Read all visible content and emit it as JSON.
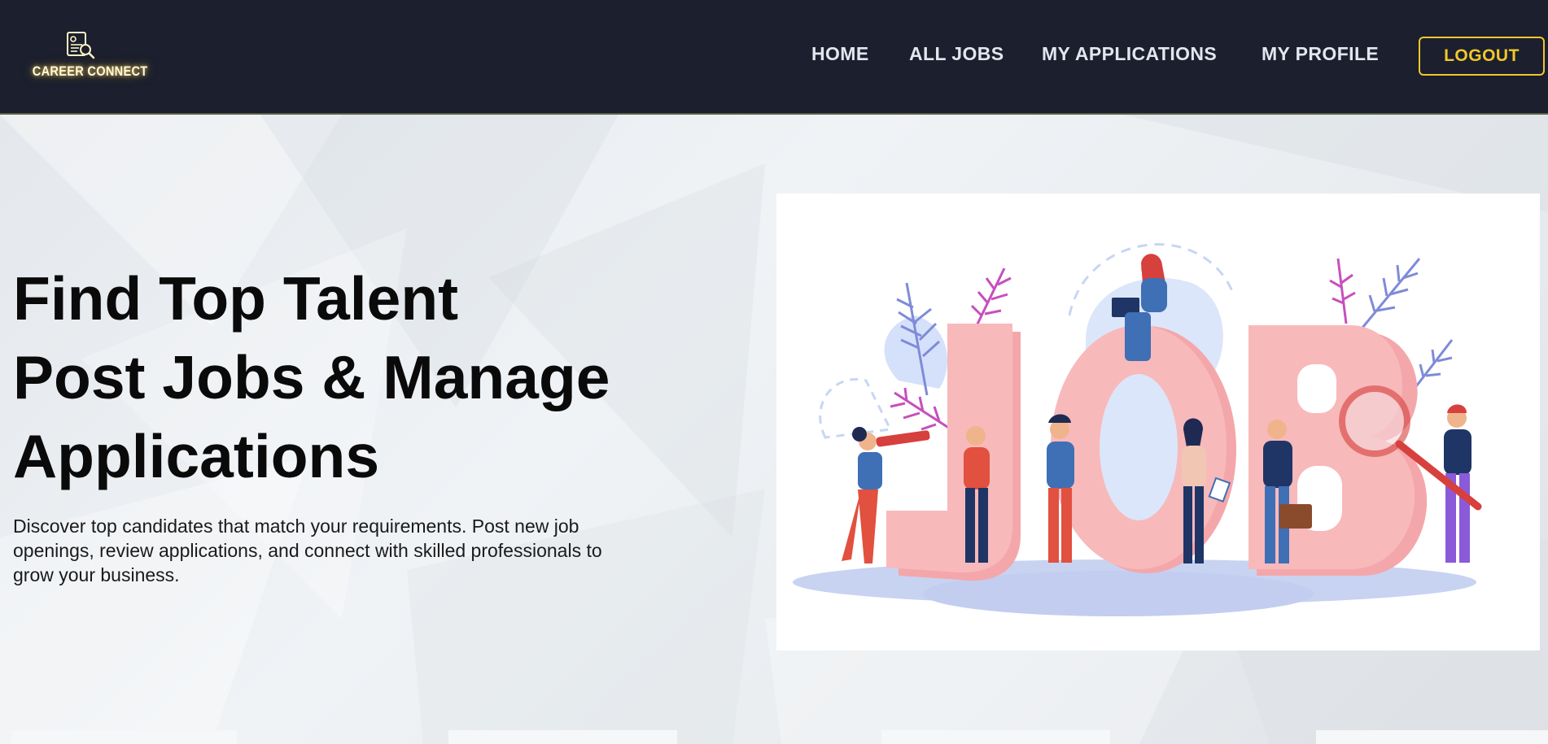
{
  "brand": {
    "name": "CAREER CONNECT",
    "icon": "resume-search-icon"
  },
  "nav": {
    "items": [
      {
        "label": "HOME"
      },
      {
        "label": "ALL JOBS"
      },
      {
        "label": "MY APPLICATIONS"
      },
      {
        "label": "MY PROFILE"
      }
    ],
    "logout_label": "LOGOUT"
  },
  "hero": {
    "title_lines": [
      "Find Top Talent",
      "Post Jobs & Manage",
      "Applications"
    ],
    "description": "Discover top candidates that match your requirements. Post new job openings, review applications, and connect with skilled professionals to grow your business.",
    "illustration": {
      "text": "JOB",
      "icon": "job-search-illustration"
    }
  },
  "colors": {
    "header_bg": "#1b1f2e",
    "accent": "#f2c72b",
    "nav_text": "#e3e6ee",
    "title_text": "#0a0a0a"
  }
}
